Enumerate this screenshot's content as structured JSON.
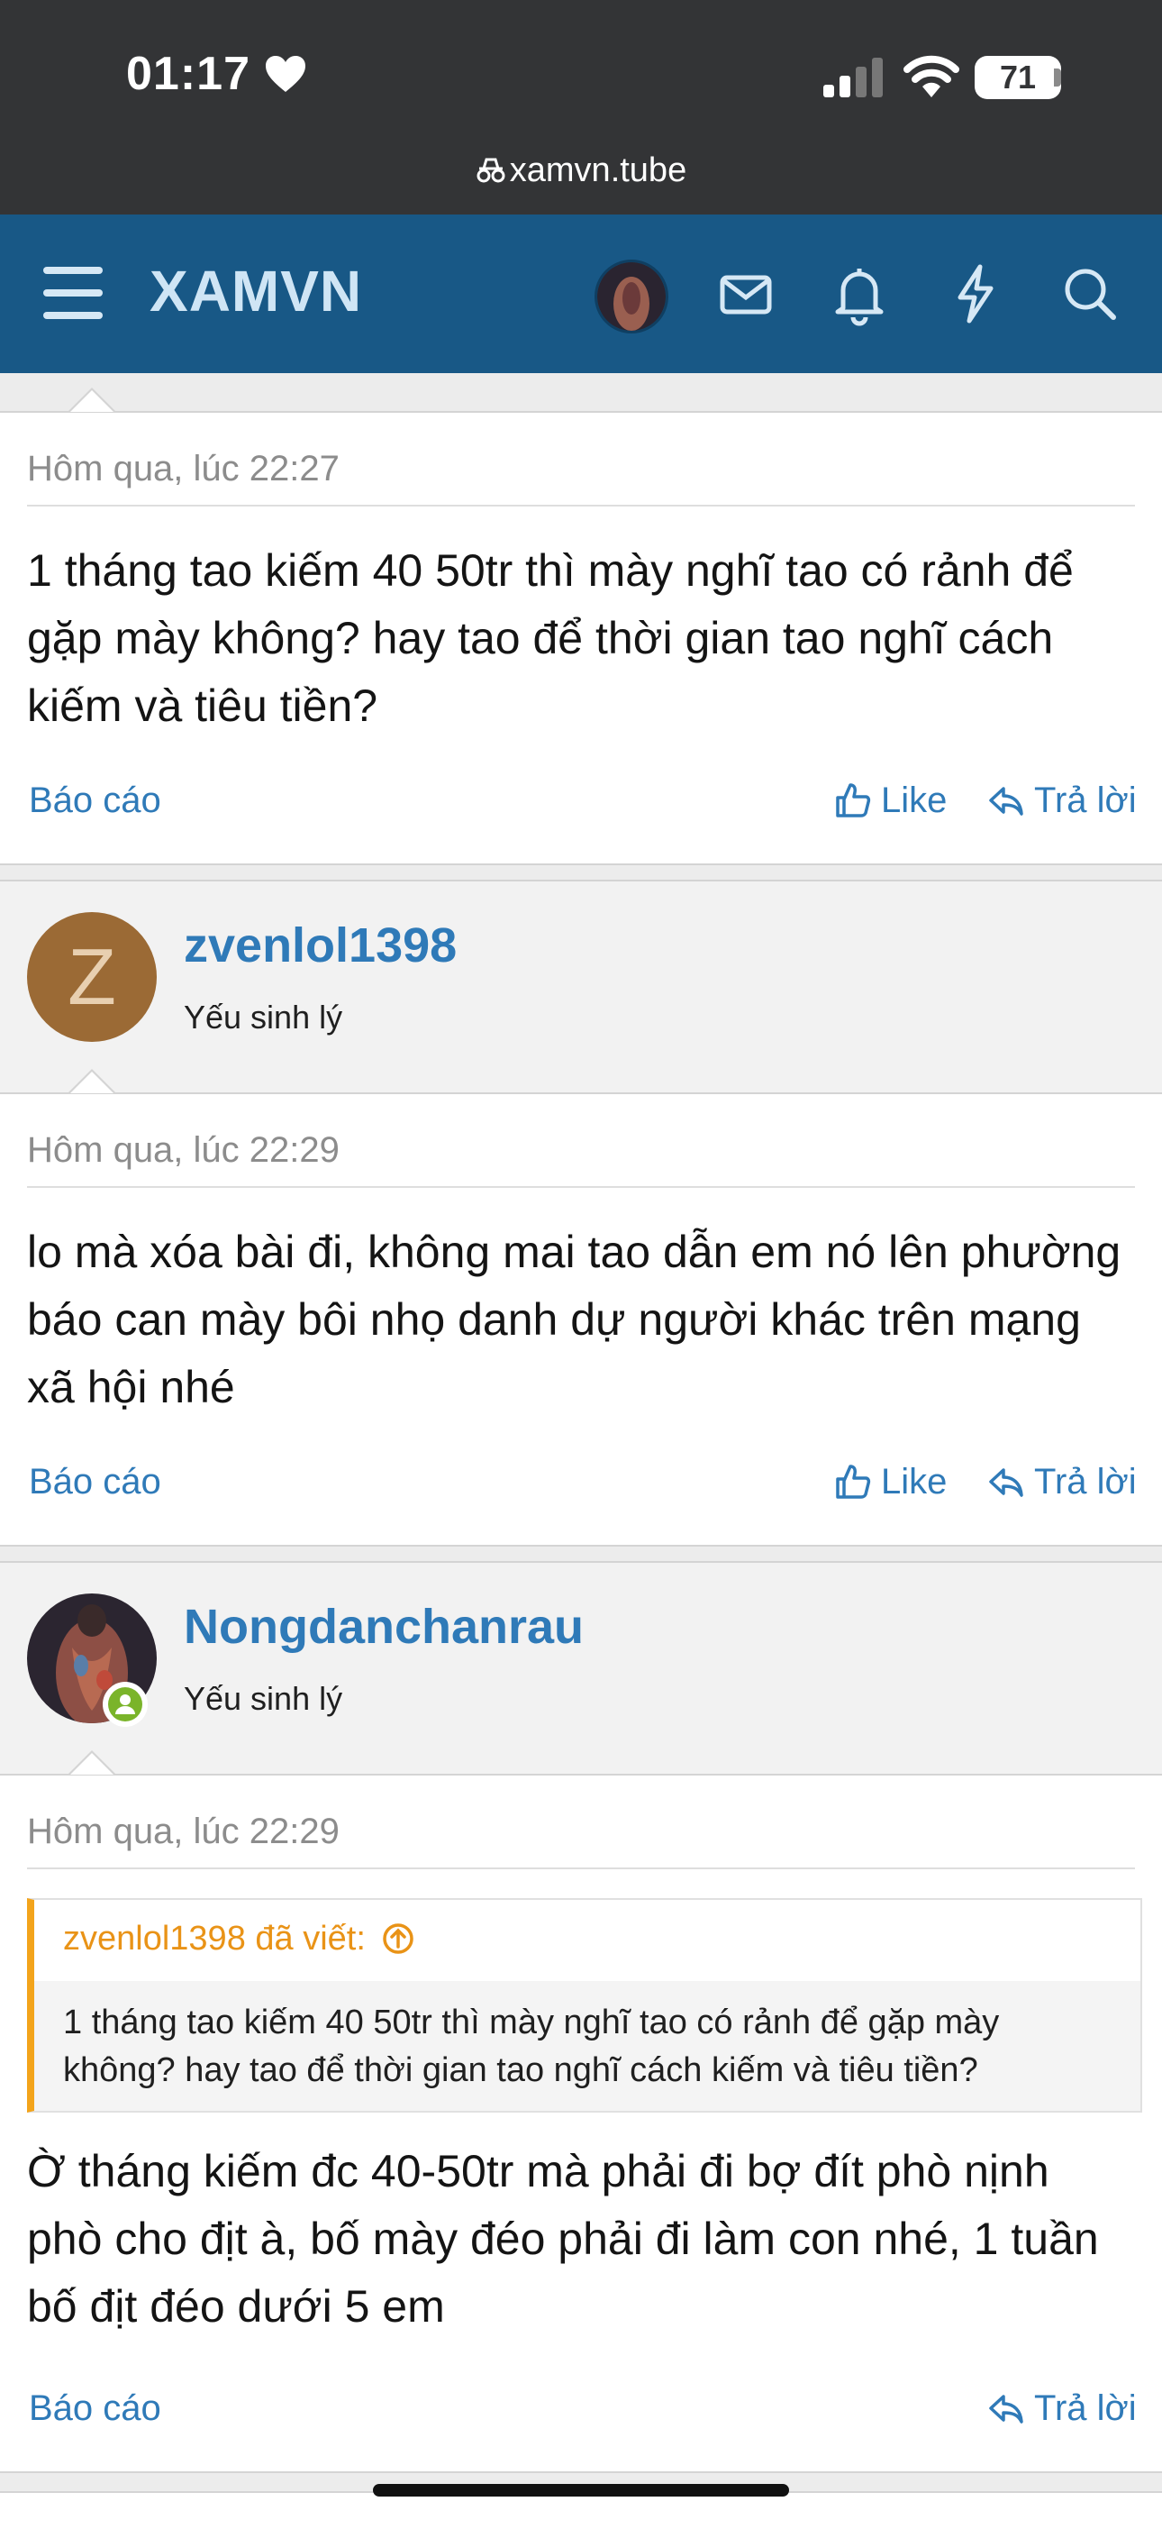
{
  "status_bar": {
    "time": "01:17",
    "battery": "71"
  },
  "browser": {
    "url": "xamvn.tube"
  },
  "nav": {
    "logo": "XAMVN"
  },
  "colors": {
    "nav_bg": "#185886",
    "accent": "#2f7ab8",
    "quote_accent": "#f3a41b",
    "online": "#7ab42a"
  },
  "posts": [
    {
      "time": "Hôm qua, lúc 22:27",
      "body": "1 tháng tao kiếm 40 50tr thì mày nghĩ tao có rảnh để gặp mày không? hay tao để thời gian tao nghĩ cách kiếm và tiêu tiền?",
      "report": "Báo cáo",
      "like": "Like",
      "reply": "Trả lời"
    },
    {
      "username": "zvenlol1398",
      "avatar_letter": "Z",
      "user_title": "Yếu sinh lý",
      "time": "Hôm qua, lúc 22:29",
      "body": "lo mà xóa bài đi, không mai tao dẫn em nó lên phường báo can mày bôi nhọ danh dự người khác trên mạng xã hội nhé",
      "report": "Báo cáo",
      "like": "Like",
      "reply": "Trả lời"
    },
    {
      "username": "Nongdanchanrau",
      "user_title": "Yếu sinh lý",
      "time": "Hôm qua, lúc 22:29",
      "quote_author": "zvenlol1398 đã viết:",
      "quote_text": "1 tháng tao kiếm 40 50tr thì mày nghĩ tao có rảnh để gặp mày không? hay tao để thời gian tao nghĩ cách kiếm và tiêu tiền?",
      "body": "Ờ tháng kiếm đc 40-50tr mà phải đi bợ đít phò nịnh phò cho địt à, bố mày đéo phải đi làm con nhé, 1 tuần bố địt đéo dưới 5 em",
      "report": "Báo cáo",
      "reply": "Trả lời"
    }
  ]
}
